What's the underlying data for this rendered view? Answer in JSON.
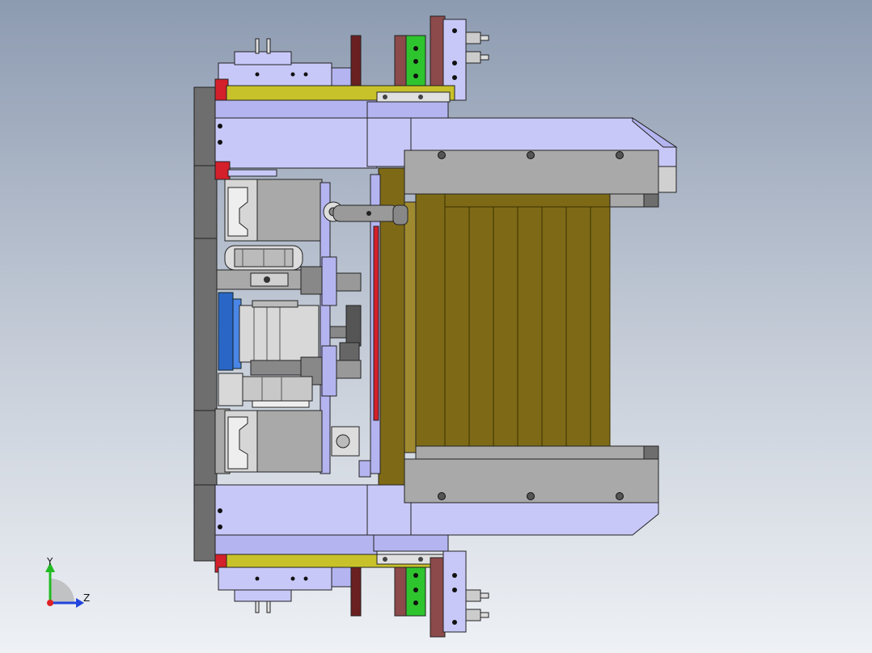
{
  "view": {
    "triad": {
      "y_label": "Y",
      "z_label": "Z"
    }
  },
  "colors": {
    "lavender": "#b4b4f0",
    "lavender_light": "#c8c8f8",
    "olive": "#7e6a16",
    "olive_dark": "#5d4e0c",
    "yellow": "#c8c22a",
    "gray": "#a9a9a9",
    "gray_dark": "#6e6e6e",
    "red": "#d4202a",
    "green": "#2ec42e",
    "brown": "#8c4a4a",
    "maroon": "#6a2020",
    "blue": "#2a66c6",
    "axis_y": "#22bb22",
    "axis_z": "#2244dd",
    "axis_x": "#dd2222"
  }
}
